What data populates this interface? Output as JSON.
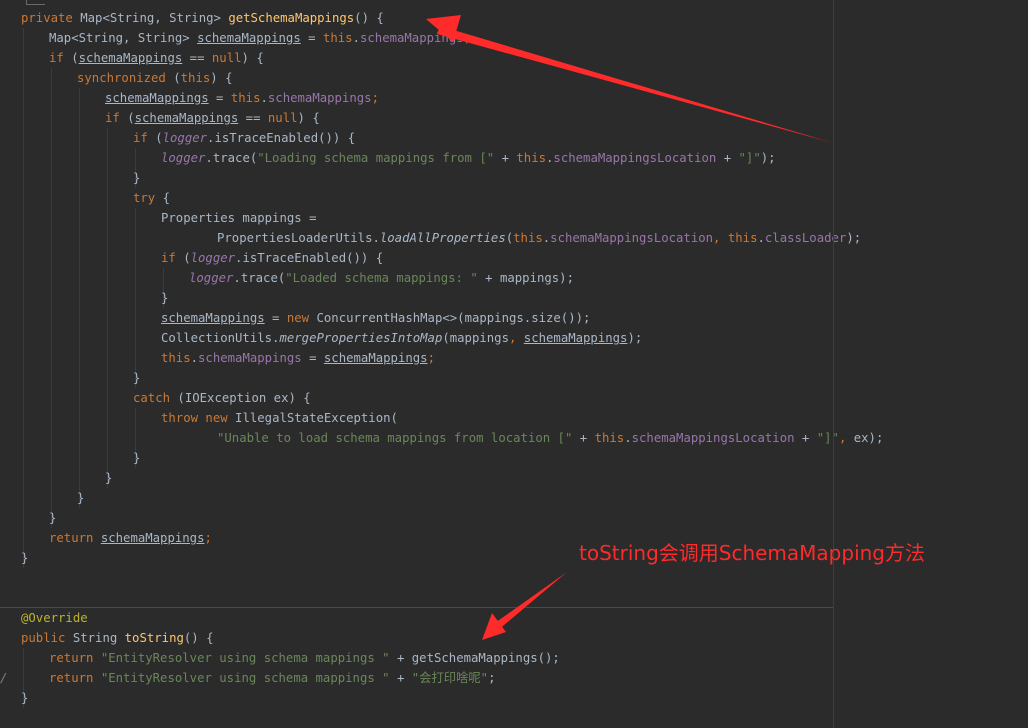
{
  "code": [
    {
      "name": "code-line-getschemamappings-signature",
      "tokens": [
        {
          "t": "private ",
          "c": "kw"
        },
        {
          "t": "Map<String, String> "
        },
        {
          "t": "getSchemaMappings",
          "c": "fn"
        },
        {
          "t": "() {"
        }
      ]
    },
    {
      "name": "code-line-local-declaration",
      "tokens": [
        {
          "t": "Map<String, String> "
        },
        {
          "t": "schemaMappings",
          "c": "loc"
        },
        {
          "t": " = "
        },
        {
          "t": "this",
          "c": "kw"
        },
        {
          "t": "."
        },
        {
          "t": "schemaMappings",
          "c": "fld"
        },
        {
          "t": ";",
          "c": "kw"
        }
      ]
    },
    {
      "name": "code-line-if-null-check",
      "tokens": [
        {
          "t": "if ",
          "c": "kw"
        },
        {
          "t": "("
        },
        {
          "t": "schemaMappings",
          "c": "loc"
        },
        {
          "t": " == "
        },
        {
          "t": "null",
          "c": "kw"
        },
        {
          "t": ") {"
        }
      ]
    },
    {
      "name": "code-line-synchronized",
      "tokens": [
        {
          "t": "synchronized ",
          "c": "kw"
        },
        {
          "t": "("
        },
        {
          "t": "this",
          "c": "kw"
        },
        {
          "t": ") {"
        }
      ]
    },
    {
      "name": "code-line-reassign",
      "tokens": [
        {
          "t": "schemaMappings",
          "c": "loc"
        },
        {
          "t": " = "
        },
        {
          "t": "this",
          "c": "kw"
        },
        {
          "t": "."
        },
        {
          "t": "schemaMappings",
          "c": "fld"
        },
        {
          "t": ";",
          "c": "kw"
        }
      ]
    },
    {
      "name": "code-line-inner-null-check",
      "tokens": [
        {
          "t": "if ",
          "c": "kw"
        },
        {
          "t": "("
        },
        {
          "t": "schemaMappings",
          "c": "loc"
        },
        {
          "t": " == "
        },
        {
          "t": "null",
          "c": "kw"
        },
        {
          "t": ") {"
        }
      ]
    },
    {
      "name": "code-line-trace-enabled-check",
      "tokens": [
        {
          "t": "if ",
          "c": "kw"
        },
        {
          "t": "("
        },
        {
          "t": "logger",
          "c": "it"
        },
        {
          "t": ".isTraceEnabled()) {"
        }
      ]
    },
    {
      "name": "code-line-trace-loading",
      "tokens": [
        {
          "t": "logger",
          "c": "it"
        },
        {
          "t": ".trace("
        },
        {
          "t": "\"Loading schema mappings from [\"",
          "c": "str"
        },
        {
          "t": " + "
        },
        {
          "t": "this",
          "c": "kw"
        },
        {
          "t": "."
        },
        {
          "t": "schemaMappingsLocation",
          "c": "fld"
        },
        {
          "t": " + "
        },
        {
          "t": "\"]\"",
          "c": "str"
        },
        {
          "t": ");"
        }
      ]
    },
    {
      "name": "code-line-close-brace",
      "tokens": [
        {
          "t": "}"
        }
      ]
    },
    {
      "name": "code-line-try",
      "tokens": [
        {
          "t": "try ",
          "c": "kw"
        },
        {
          "t": "{"
        }
      ]
    },
    {
      "name": "code-line-properties-declaration",
      "tokens": [
        {
          "t": "Properties mappings ="
        }
      ]
    },
    {
      "name": "code-line-load-all-properties",
      "tokens": [
        {
          "t": "PropertiesLoaderUtils."
        },
        {
          "t": "loadAllProperties",
          "c": "sit"
        },
        {
          "t": "("
        },
        {
          "t": "this",
          "c": "kw"
        },
        {
          "t": "."
        },
        {
          "t": "schemaMappingsLocation",
          "c": "fld"
        },
        {
          "t": ", ",
          "c": "kw"
        },
        {
          "t": "this",
          "c": "kw"
        },
        {
          "t": "."
        },
        {
          "t": "classLoader",
          "c": "fld"
        },
        {
          "t": ");"
        }
      ]
    },
    {
      "name": "code-line-trace-enabled-check-2",
      "tokens": [
        {
          "t": "if ",
          "c": "kw"
        },
        {
          "t": "("
        },
        {
          "t": "logger",
          "c": "it"
        },
        {
          "t": ".isTraceEnabled()) {"
        }
      ]
    },
    {
      "name": "code-line-trace-loaded",
      "tokens": [
        {
          "t": "logger",
          "c": "it"
        },
        {
          "t": ".trace("
        },
        {
          "t": "\"Loaded schema mappings: \"",
          "c": "str"
        },
        {
          "t": " + mappings);"
        }
      ]
    },
    {
      "name": "code-line-close-brace",
      "tokens": [
        {
          "t": "}"
        }
      ]
    },
    {
      "name": "code-line-new-concurrent-map",
      "tokens": [
        {
          "t": "schemaMappings",
          "c": "loc"
        },
        {
          "t": " = "
        },
        {
          "t": "new ",
          "c": "kw"
        },
        {
          "t": "ConcurrentHashMap<>(mappings.size());"
        }
      ]
    },
    {
      "name": "code-line-merge-properties",
      "tokens": [
        {
          "t": "CollectionUtils."
        },
        {
          "t": "mergePropertiesIntoMap",
          "c": "sit"
        },
        {
          "t": "(mappings"
        },
        {
          "t": ", ",
          "c": "kw"
        },
        {
          "t": "schemaMappings",
          "c": "loc"
        },
        {
          "t": ");"
        }
      ]
    },
    {
      "name": "code-line-assign-field",
      "tokens": [
        {
          "t": "this",
          "c": "kw"
        },
        {
          "t": "."
        },
        {
          "t": "schemaMappings",
          "c": "fld"
        },
        {
          "t": " = "
        },
        {
          "t": "schemaMappings",
          "c": "loc"
        },
        {
          "t": ";",
          "c": "kw"
        }
      ]
    },
    {
      "name": "code-line-close-brace",
      "tokens": [
        {
          "t": "}"
        }
      ]
    },
    {
      "name": "code-line-catch",
      "tokens": [
        {
          "t": "catch ",
          "c": "kw"
        },
        {
          "t": "(IOException ex) {"
        }
      ]
    },
    {
      "name": "code-line-throw",
      "tokens": [
        {
          "t": "throw new ",
          "c": "kw"
        },
        {
          "t": "IllegalStateException("
        }
      ]
    },
    {
      "name": "code-line-exception-message",
      "tokens": [
        {
          "t": "\"Unable to load schema mappings from location [\"",
          "c": "str"
        },
        {
          "t": " + "
        },
        {
          "t": "this",
          "c": "kw"
        },
        {
          "t": "."
        },
        {
          "t": "schemaMappingsLocation",
          "c": "fld"
        },
        {
          "t": " + "
        },
        {
          "t": "\"]\"",
          "c": "str"
        },
        {
          "t": ", ",
          "c": "kw"
        },
        {
          "t": "ex);"
        }
      ]
    },
    {
      "name": "code-line-close-brace",
      "tokens": [
        {
          "t": "}"
        }
      ]
    },
    {
      "name": "code-line-close-brace",
      "tokens": [
        {
          "t": "}"
        }
      ]
    },
    {
      "name": "code-line-close-brace",
      "tokens": [
        {
          "t": "}"
        }
      ]
    },
    {
      "name": "code-line-close-brace",
      "tokens": [
        {
          "t": "}"
        }
      ]
    },
    {
      "name": "code-line-return-mappings",
      "tokens": [
        {
          "t": "return ",
          "c": "kw"
        },
        {
          "t": "schemaMappings",
          "c": "loc"
        },
        {
          "t": ";",
          "c": "kw"
        }
      ]
    },
    {
      "name": "code-line-close-brace",
      "tokens": [
        {
          "t": "}"
        }
      ]
    },
    {
      "name": "code-line-override-annotation",
      "tokens": [
        {
          "t": "@Override",
          "c": "ann"
        }
      ]
    },
    {
      "name": "code-line-tostring-signature",
      "tokens": [
        {
          "t": "public ",
          "c": "kw"
        },
        {
          "t": "String "
        },
        {
          "t": "toString",
          "c": "fn"
        },
        {
          "t": "() {"
        }
      ]
    },
    {
      "name": "code-line-return-tostring",
      "tokens": [
        {
          "t": "return ",
          "c": "kw"
        },
        {
          "t": "\"EntityResolver using schema mappings \"",
          "c": "str"
        },
        {
          "t": " + getSchemaMappings();"
        }
      ]
    },
    {
      "name": "code-line-return-tostring-alt",
      "tokens": [
        {
          "t": "return ",
          "c": "kw"
        },
        {
          "t": "\"EntityResolver using schema mappings \"",
          "c": "str"
        },
        {
          "t": " + "
        },
        {
          "t": "\"会打印啥呢\"",
          "c": "str"
        },
        {
          "t": ";"
        }
      ]
    },
    {
      "name": "code-line-close-brace",
      "tokens": [
        {
          "t": "}"
        }
      ]
    }
  ],
  "annotation": {
    "text": "toString会调用SchemaMapping方法",
    "color": "#ff2a2a"
  },
  "colors": {
    "background": "#2b2b2b",
    "default_text": "#a9b7c6",
    "keyword": "#cc7832",
    "string": "#6a8759",
    "field": "#9876aa",
    "method_declaration": "#ffc66d",
    "annotation": "#bbb529"
  }
}
